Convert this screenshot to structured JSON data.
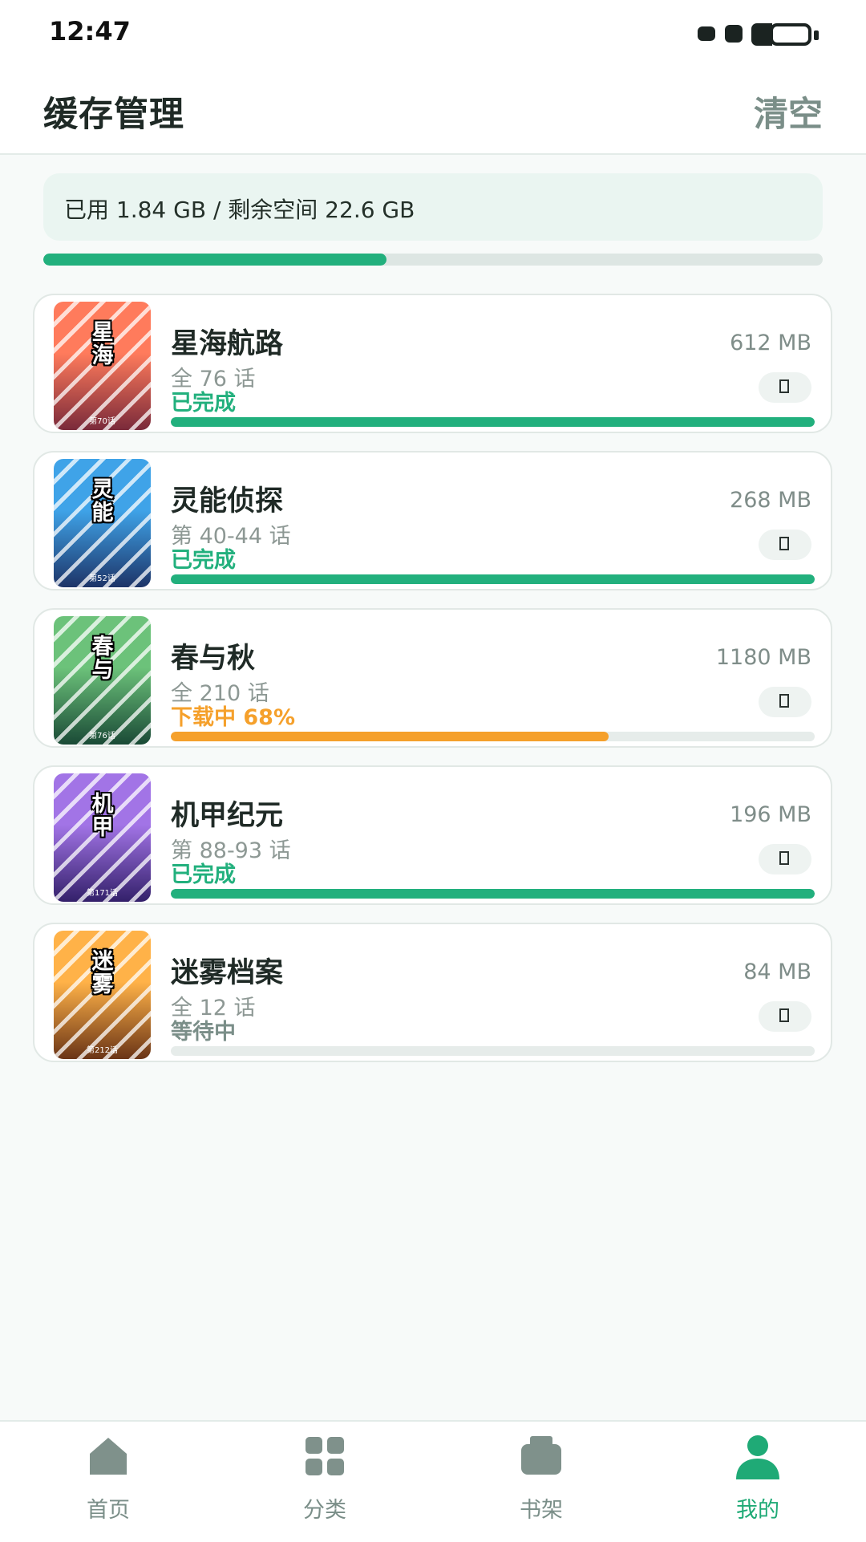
{
  "status_bar": {
    "time": "12:47"
  },
  "header": {
    "title": "缓存管理",
    "clear_label": "清空"
  },
  "storage": {
    "text": "已用 1.84 GB / 剩余空间 22.6 GB",
    "usage_fraction": 0.44
  },
  "colors": {
    "accent": "#22b07d",
    "downloading": "#f5a02b",
    "waiting": "#7a8e88",
    "track": "#e6ecea"
  },
  "items": [
    {
      "cover_text": "星海",
      "cover_ep": "第70话",
      "cover_colors": [
        "#ff7b5c",
        "#7a2a3a"
      ],
      "title": "星海航路",
      "size": "612 MB",
      "episodes": "全 76 话",
      "status": "已完成",
      "status_kind": "done",
      "progress": 1.0
    },
    {
      "cover_text": "灵能",
      "cover_ep": "第52话",
      "cover_colors": [
        "#3fa3e8",
        "#1d3468"
      ],
      "title": "灵能侦探",
      "size": "268 MB",
      "episodes": "第 40-44 话",
      "status": "已完成",
      "status_kind": "done",
      "progress": 1.0
    },
    {
      "cover_text": "春与",
      "cover_ep": "第76话",
      "cover_colors": [
        "#6cc27a",
        "#1a4a36"
      ],
      "title": "春与秋",
      "size": "1180 MB",
      "episodes": "全 210 话",
      "status": "下载中 68%",
      "status_kind": "downloading",
      "progress": 0.68
    },
    {
      "cover_text": "机甲",
      "cover_ep": "第171话",
      "cover_colors": [
        "#a274e6",
        "#33206a"
      ],
      "title": "机甲纪元",
      "size": "196 MB",
      "episodes": "第 88-93 话",
      "status": "已完成",
      "status_kind": "done",
      "progress": 1.0
    },
    {
      "cover_text": "迷雾",
      "cover_ep": "第212话",
      "cover_colors": [
        "#ffb248",
        "#6a3416"
      ],
      "title": "迷雾档案",
      "size": "84 MB",
      "episodes": "全 12 话",
      "status": "等待中",
      "status_kind": "waiting",
      "progress": 0.0
    }
  ],
  "tabs": [
    {
      "label": "首页",
      "icon": "home-icon",
      "active": false
    },
    {
      "label": "分类",
      "icon": "grid-icon",
      "active": false
    },
    {
      "label": "书架",
      "icon": "bookshelf-icon",
      "active": false
    },
    {
      "label": "我的",
      "icon": "user-icon",
      "active": true
    }
  ]
}
